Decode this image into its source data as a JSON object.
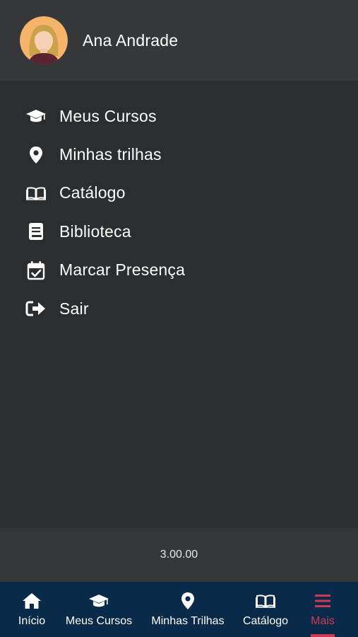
{
  "user": {
    "name": "Ana Andrade"
  },
  "menu": {
    "items": [
      {
        "label": "Meus Cursos",
        "icon": "graduation-cap-icon"
      },
      {
        "label": "Minhas trilhas",
        "icon": "map-pin-icon"
      },
      {
        "label": "Catálogo",
        "icon": "open-book-icon"
      },
      {
        "label": "Biblioteca",
        "icon": "book-icon"
      },
      {
        "label": "Marcar Presença",
        "icon": "calendar-check-icon"
      },
      {
        "label": "Sair",
        "icon": "sign-out-icon"
      }
    ]
  },
  "footer": {
    "version": "3.00.00"
  },
  "bottom_nav": {
    "items": [
      {
        "label": "Início",
        "icon": "home-icon"
      },
      {
        "label": "Meus Cursos",
        "icon": "graduation-cap-icon"
      },
      {
        "label": "Minhas Trilhas",
        "icon": "map-pin-icon"
      },
      {
        "label": "Catálogo",
        "icon": "open-book-icon"
      },
      {
        "label": "Mais",
        "icon": "hamburger-icon",
        "active": true
      }
    ]
  },
  "colors": {
    "background": "#2b2d2f",
    "header": "#353739",
    "nav_background": "#0a2a4a",
    "accent": "#d13a52"
  }
}
